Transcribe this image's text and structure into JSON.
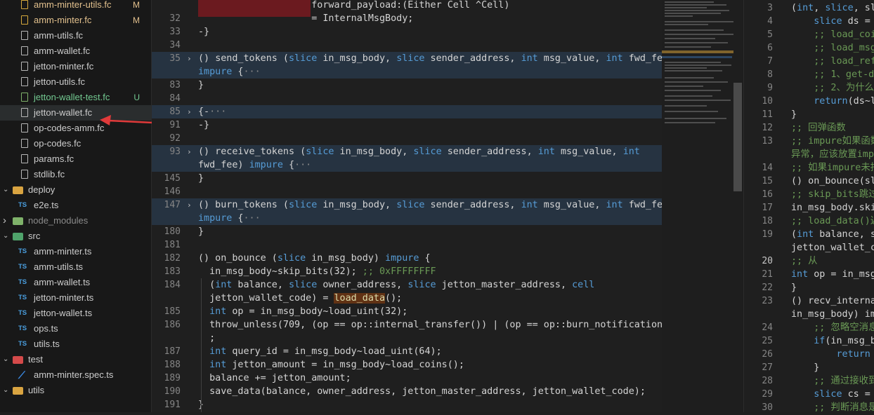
{
  "explorer": {
    "items": [
      {
        "label": "amm-minter-utils.fc",
        "type": "fc",
        "badge": "M",
        "state": "modified"
      },
      {
        "label": "amm-minter.fc",
        "type": "fc",
        "badge": "M",
        "state": "modified"
      },
      {
        "label": "amm-utils.fc",
        "type": "fc",
        "badge": "",
        "state": "normal"
      },
      {
        "label": "amm-wallet.fc",
        "type": "fc",
        "badge": "",
        "state": "normal"
      },
      {
        "label": "jetton-minter.fc",
        "type": "fc",
        "badge": "",
        "state": "normal"
      },
      {
        "label": "jetton-utils.fc",
        "type": "fc",
        "badge": "",
        "state": "normal"
      },
      {
        "label": "jetton-wallet-test.fc",
        "type": "fc",
        "badge": "U",
        "state": "untracked"
      },
      {
        "label": "jetton-wallet.fc",
        "type": "fc",
        "badge": "",
        "state": "selected"
      },
      {
        "label": "op-codes-amm.fc",
        "type": "fc",
        "badge": "",
        "state": "normal"
      },
      {
        "label": "op-codes.fc",
        "type": "fc",
        "badge": "",
        "state": "normal"
      },
      {
        "label": "params.fc",
        "type": "fc",
        "badge": "",
        "state": "normal"
      },
      {
        "label": "stdlib.fc",
        "type": "fc",
        "badge": "",
        "state": "normal"
      },
      {
        "label": "deploy",
        "type": "folder",
        "badge": "",
        "state": "open"
      },
      {
        "label": "e2e.ts",
        "type": "ts",
        "badge": "",
        "state": "normal"
      },
      {
        "label": "node_modules",
        "type": "folder-closed",
        "badge": "",
        "state": "dim"
      },
      {
        "label": "src",
        "type": "folder",
        "badge": "",
        "state": "open"
      },
      {
        "label": "amm-minter.ts",
        "type": "ts",
        "badge": "",
        "state": "normal"
      },
      {
        "label": "amm-utils.ts",
        "type": "ts",
        "badge": "",
        "state": "normal"
      },
      {
        "label": "amm-wallet.ts",
        "type": "ts",
        "badge": "",
        "state": "normal"
      },
      {
        "label": "jetton-minter.ts",
        "type": "ts",
        "badge": "",
        "state": "normal"
      },
      {
        "label": "jetton-wallet.ts",
        "type": "ts",
        "badge": "",
        "state": "normal"
      },
      {
        "label": "ops.ts",
        "type": "ts",
        "badge": "",
        "state": "normal"
      },
      {
        "label": "utils.ts",
        "type": "ts",
        "badge": "",
        "state": "normal"
      },
      {
        "label": "test",
        "type": "folder",
        "badge": "",
        "state": "open"
      },
      {
        "label": "amm-minter.spec.ts",
        "type": "spec",
        "badge": "",
        "state": "normal"
      },
      {
        "label": "utils",
        "type": "folder",
        "badge": "",
        "state": "open"
      }
    ]
  },
  "colors": {
    "modified": "#e2c08d",
    "untracked": "#73c991",
    "normal": "#cccccc",
    "dim": "#8b8b8b",
    "accent": "#569cd6",
    "annotation_arrow": "#e03a3a"
  },
  "editor": {
    "lines": [
      {
        "n": "",
        "segs": [
          {
            "t": "                    forward_payload:(Either Cell ^Cell)",
            "c": "str"
          }
        ]
      },
      {
        "n": "32",
        "segs": [
          {
            "t": "                    = InternalMsgBody;",
            "c": "str"
          }
        ]
      },
      {
        "n": "33",
        "segs": [
          {
            "t": "-}",
            "c": "str"
          }
        ]
      },
      {
        "n": "34",
        "segs": []
      },
      {
        "n": "35",
        "fold": true,
        "segs": [
          {
            "t": "() ",
            "c": "str"
          },
          {
            "t": "send_tokens",
            "c": "str"
          },
          {
            "t": " (",
            "c": "str"
          },
          {
            "t": "slice",
            "c": "kw"
          },
          {
            "t": " in_msg_body, ",
            "c": "str"
          },
          {
            "t": "slice",
            "c": "kw"
          },
          {
            "t": " sender_address, ",
            "c": "str"
          },
          {
            "t": "int",
            "c": "kw"
          },
          {
            "t": " msg_value, ",
            "c": "str"
          },
          {
            "t": "int",
            "c": "kw"
          },
          {
            "t": " fwd_fee)",
            "c": "str"
          }
        ]
      },
      {
        "n": "",
        "fold": true,
        "segs": [
          {
            "t": "impure",
            "c": "kw"
          },
          {
            "t": " {",
            "c": "str"
          },
          {
            "t": "···",
            "c": "ell"
          }
        ]
      },
      {
        "n": "83",
        "segs": [
          {
            "t": "}",
            "c": "str"
          }
        ]
      },
      {
        "n": "84",
        "segs": []
      },
      {
        "n": "85",
        "fold": true,
        "segs": [
          {
            "t": "{-",
            "c": "str"
          },
          {
            "t": "···",
            "c": "ell"
          }
        ]
      },
      {
        "n": "91",
        "segs": [
          {
            "t": "-}",
            "c": "str"
          }
        ]
      },
      {
        "n": "92",
        "segs": []
      },
      {
        "n": "93",
        "fold": true,
        "segs": [
          {
            "t": "() receive_tokens (",
            "c": "str"
          },
          {
            "t": "slice",
            "c": "kw"
          },
          {
            "t": " in_msg_body, ",
            "c": "str"
          },
          {
            "t": "slice",
            "c": "kw"
          },
          {
            "t": " sender_address, ",
            "c": "str"
          },
          {
            "t": "int",
            "c": "kw"
          },
          {
            "t": " msg_value, ",
            "c": "str"
          },
          {
            "t": "int",
            "c": "kw"
          }
        ]
      },
      {
        "n": "",
        "fold": true,
        "segs": [
          {
            "t": "fwd_fee) ",
            "c": "str"
          },
          {
            "t": "impure",
            "c": "kw"
          },
          {
            "t": " {",
            "c": "str"
          },
          {
            "t": "···",
            "c": "ell"
          }
        ]
      },
      {
        "n": "145",
        "segs": [
          {
            "t": "}",
            "c": "str"
          }
        ]
      },
      {
        "n": "146",
        "segs": []
      },
      {
        "n": "147",
        "fold": true,
        "segs": [
          {
            "t": "() burn_tokens (",
            "c": "str"
          },
          {
            "t": "slice",
            "c": "kw"
          },
          {
            "t": " in_msg_body, ",
            "c": "str"
          },
          {
            "t": "slice",
            "c": "kw"
          },
          {
            "t": " sender_address, ",
            "c": "str"
          },
          {
            "t": "int",
            "c": "kw"
          },
          {
            "t": " msg_value, ",
            "c": "str"
          },
          {
            "t": "int",
            "c": "kw"
          },
          {
            "t": " fwd_fee)",
            "c": "str"
          }
        ]
      },
      {
        "n": "",
        "fold": true,
        "segs": [
          {
            "t": "impure",
            "c": "kw"
          },
          {
            "t": " {",
            "c": "str"
          },
          {
            "t": "···",
            "c": "ell"
          }
        ]
      },
      {
        "n": "180",
        "segs": [
          {
            "t": "}",
            "c": "str"
          }
        ]
      },
      {
        "n": "181",
        "segs": []
      },
      {
        "n": "182",
        "segs": [
          {
            "t": "() on_bounce (",
            "c": "str"
          },
          {
            "t": "slice",
            "c": "kw"
          },
          {
            "t": " in_msg_body) ",
            "c": "str"
          },
          {
            "t": "impure",
            "c": "kw"
          },
          {
            "t": " {",
            "c": "str"
          }
        ]
      },
      {
        "n": "183",
        "segs": [
          {
            "t": "  in_msg_body~skip_bits(32); ",
            "c": "str"
          },
          {
            "t": ";; 0xFFFFFFFF",
            "c": "cm"
          }
        ]
      },
      {
        "n": "184",
        "segs": [
          {
            "t": "  (",
            "c": "str"
          },
          {
            "t": "int",
            "c": "kw"
          },
          {
            "t": " balance, ",
            "c": "str"
          },
          {
            "t": "slice",
            "c": "kw"
          },
          {
            "t": " owner_address, ",
            "c": "str"
          },
          {
            "t": "slice",
            "c": "kw"
          },
          {
            "t": " jetton_master_address, ",
            "c": "str"
          },
          {
            "t": "cell",
            "c": "kw"
          }
        ]
      },
      {
        "n": "",
        "segs": [
          {
            "t": "  jetton_wallet_code) = ",
            "c": "str"
          },
          {
            "t": "load_data",
            "c": "hlfn"
          },
          {
            "t": "();",
            "c": "str"
          }
        ]
      },
      {
        "n": "185",
        "segs": [
          {
            "t": "  ",
            "c": "str"
          },
          {
            "t": "int",
            "c": "kw"
          },
          {
            "t": " op = in_msg_body~load_uint(32);",
            "c": "str"
          }
        ]
      },
      {
        "n": "186",
        "segs": [
          {
            "t": "  throw_unless(709, (op == op::internal_transfer()) | (op == op::burn_notification()))",
            "c": "str"
          }
        ]
      },
      {
        "n": "",
        "segs": [
          {
            "t": "  ;",
            "c": "str"
          }
        ]
      },
      {
        "n": "187",
        "segs": [
          {
            "t": "  ",
            "c": "str"
          },
          {
            "t": "int",
            "c": "kw"
          },
          {
            "t": " query_id = in_msg_body~load_uint(64);",
            "c": "str"
          }
        ]
      },
      {
        "n": "188",
        "segs": [
          {
            "t": "  ",
            "c": "str"
          },
          {
            "t": "int",
            "c": "kw"
          },
          {
            "t": " jetton_amount = in_msg_body~load_coins();",
            "c": "str"
          }
        ]
      },
      {
        "n": "189",
        "segs": [
          {
            "t": "  balance += jetton_amount;",
            "c": "str"
          }
        ]
      },
      {
        "n": "190",
        "segs": [
          {
            "t": "  save_data(balance, owner_address, jetton_master_address, jetton_wallet_code);",
            "c": "str"
          }
        ]
      },
      {
        "n": "191",
        "segs": [
          {
            "t": "}",
            "c": "str"
          }
        ]
      }
    ]
  },
  "right_pane": {
    "lines": [
      {
        "n": "3",
        "segs": [
          {
            "t": "(int, slice, sl",
            "c": "str"
          }
        ]
      },
      {
        "n": "4",
        "segs": [
          {
            "t": "    slice ds = g",
            "c": "str"
          }
        ]
      },
      {
        "n": "5",
        "segs": [
          {
            "t": "    ;; load_coin",
            "c": "cm"
          }
        ]
      },
      {
        "n": "6",
        "segs": [
          {
            "t": "    ;; load_msg_",
            "c": "cm"
          }
        ]
      },
      {
        "n": "7",
        "segs": [
          {
            "t": "    ;; load_refe",
            "c": "cm"
          }
        ]
      },
      {
        "n": "8",
        "segs": [
          {
            "t": "    ;; 1、get-da",
            "c": "cm"
          }
        ]
      },
      {
        "n": "9",
        "segs": [
          {
            "t": "    ;; 2、为什么",
            "c": "cm"
          }
        ]
      },
      {
        "n": "10",
        "segs": [
          {
            "t": "    return(ds~lo",
            "c": "str"
          }
        ]
      },
      {
        "n": "11",
        "segs": [
          {
            "t": "}",
            "c": "str"
          }
        ]
      },
      {
        "n": "12",
        "segs": [
          {
            "t": ";; 回弹函数",
            "c": "cm"
          }
        ]
      },
      {
        "n": "13",
        "segs": [
          {
            "t": ";; impure如果函数",
            "c": "cm"
          }
        ]
      },
      {
        "n": "",
        "segs": [
          {
            "t": "异常，应该放置impu",
            "c": "cm"
          }
        ]
      },
      {
        "n": "14",
        "segs": [
          {
            "t": ";; 如果impure未指",
            "c": "cm"
          }
        ]
      },
      {
        "n": "15",
        "segs": [
          {
            "t": "() on_bounce(sli",
            "c": "str"
          }
        ]
      },
      {
        "n": "16",
        "segs": [
          {
            "t": ";; skip_bits跳过",
            "c": "cm"
          }
        ]
      },
      {
        "n": "17",
        "segs": [
          {
            "t": "in_msg_body.skip",
            "c": "str"
          }
        ]
      },
      {
        "n": "18",
        "segs": [
          {
            "t": ";; load_data()返",
            "c": "cm"
          }
        ]
      },
      {
        "n": "19",
        "segs": [
          {
            "t": "(int balance, sl",
            "c": "str"
          }
        ]
      },
      {
        "n": "",
        "segs": [
          {
            "t": "jetton_wallet_co",
            "c": "str"
          }
        ]
      },
      {
        "n": "20",
        "cur": true,
        "segs": [
          {
            "t": ";; 从",
            "c": "cm"
          }
        ]
      },
      {
        "n": "21",
        "segs": [
          {
            "t": "int op = in_msg_",
            "c": "str"
          }
        ]
      },
      {
        "n": "22",
        "segs": [
          {
            "t": "}",
            "c": "str"
          }
        ]
      },
      {
        "n": "23",
        "segs": [
          {
            "t": "() recv_internal",
            "c": "str"
          }
        ]
      },
      {
        "n": "",
        "segs": [
          {
            "t": "in_msg_body) imp",
            "c": "str"
          }
        ]
      },
      {
        "n": "24",
        "segs": [
          {
            "t": "    ;; 忽略空消息",
            "c": "cm"
          }
        ]
      },
      {
        "n": "25",
        "segs": [
          {
            "t": "    if(in_msg_bo",
            "c": "str"
          }
        ]
      },
      {
        "n": "26",
        "segs": [
          {
            "t": "        return (",
            "c": "str"
          }
        ]
      },
      {
        "n": "27",
        "segs": [
          {
            "t": "    }",
            "c": "str"
          }
        ]
      },
      {
        "n": "28",
        "segs": [
          {
            "t": "    ;; 通过接收到",
            "c": "cm"
          }
        ]
      },
      {
        "n": "29",
        "segs": [
          {
            "t": "    slice cs = i",
            "c": "str"
          }
        ]
      },
      {
        "n": "30",
        "segs": [
          {
            "t": "    ;; 判断消息是",
            "c": "cm"
          }
        ]
      }
    ]
  }
}
